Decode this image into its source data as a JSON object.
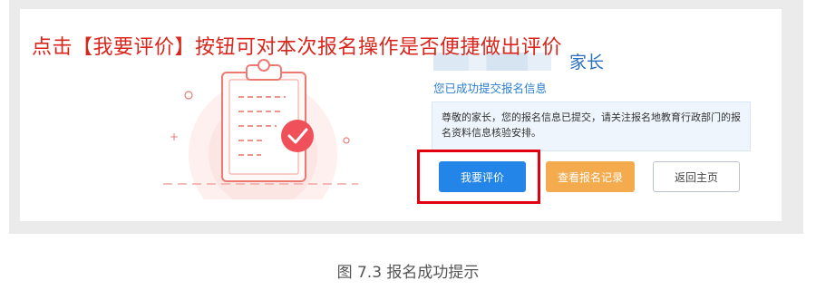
{
  "annotation": "点击【我要评价】按钮可对本次报名操作是否便捷做出评价",
  "result": {
    "parent_word": "家长",
    "success_title": "您已成功提交报名信息",
    "notice_text": "尊敬的家长，您的报名信息已提交，请关注报名地教育行政部门的报名资料信息核验安排。"
  },
  "buttons": {
    "evaluate": "我要评价",
    "view_records": "查看报名记录",
    "back_home": "返回主页"
  },
  "caption": "图 7.3  报名成功提示",
  "colors": {
    "annotation_red": "#d9261c",
    "primary_blue": "#2385e8",
    "orange": "#f3ab4d",
    "highlight_red": "#e2000e",
    "check_red": "#f0505a"
  },
  "icons": [
    "clipboard-icon",
    "checkmark-icon"
  ]
}
